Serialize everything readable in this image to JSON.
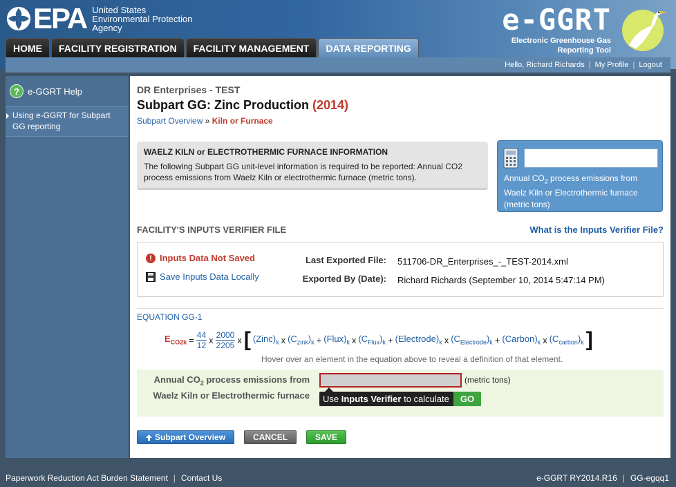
{
  "header": {
    "agency_word": "EPA",
    "agency_lines": [
      "United States",
      "Environmental Protection",
      "Agency"
    ],
    "app_name": "e-GGRT",
    "app_sub_lines": [
      "Electronic Greenhouse Gas",
      "Reporting Tool"
    ]
  },
  "nav": {
    "tabs": [
      {
        "label": "HOME",
        "active": false
      },
      {
        "label": "FACILITY REGISTRATION",
        "active": false
      },
      {
        "label": "FACILITY MANAGEMENT",
        "active": false
      },
      {
        "label": "DATA REPORTING",
        "active": true
      }
    ]
  },
  "userbar": {
    "greeting": "Hello, Richard Richards",
    "my_profile": "My Profile",
    "logout": "Logout",
    "sep": "|"
  },
  "sidebar": {
    "help_label": "e-GGRT Help",
    "help_icon": "?",
    "link_label": "Using e-GGRT for Subpart GG reporting"
  },
  "main": {
    "org_name": "DR Enterprises - TEST",
    "title": "Subpart GG: Zinc Production",
    "year": "(2014)",
    "breadcrumb": {
      "link": "Subpart Overview",
      "separator": " » ",
      "current": "Kiln or Furnace"
    },
    "info": {
      "title": "WAELZ KILN or ELECTROTHERMIC FURNACE INFORMATION",
      "text": "The following Subpart GG unit-level information is required to be reported: Annual CO2 process emissions from Waelz Kiln or electrothermic furnace (metric tons)."
    },
    "calc": {
      "text_pre": "Annual CO",
      "text_sub": "2",
      "text_post": " process emissions from Waelz Kiln or Electrothermic furnace (metric tons)",
      "value": ""
    },
    "verifier": {
      "section_title": "FACILITY'S INPUTS VERIFIER FILE",
      "what_link": "What is the Inputs Verifier File?",
      "error_text": "Inputs Data Not Saved",
      "error_icon": "!",
      "save_link": "Save Inputs Data Locally",
      "last_exported_label": "Last Exported File:",
      "last_exported_value": "511706-DR_Enterprises_-_TEST-2014.xml",
      "exported_by_label": "Exported By (Date):",
      "exported_by_value": "Richard Richards (September 10, 2014 5:47:14 PM)"
    },
    "equation": {
      "title": "EQUATION GG-1",
      "E": "E",
      "E_sub": "CO2k",
      "eq": "=",
      "f1_num": "44",
      "f1_den": "12",
      "x": "x",
      "f2_num": "2000",
      "f2_den": "2205",
      "lbracket": "[",
      "rbracket": "]",
      "plus": "+",
      "zinc": "(Zinc)",
      "czink": "(C",
      "czink_sub": "zink",
      "flux": "(Flux)",
      "cflux": "(C",
      "cflux_sub": "Flux",
      "electrode": "(Electrode)",
      "celectrode": "(C",
      "celectrode_sub": "Electrode",
      "carbon": "(Carbon)",
      "ccarbon": "(C",
      "ccarbon_sub": "carbon",
      "close_paren": ")",
      "k": "k",
      "hover_note": "Hover over an element in the equation above to reveal a definition of that element."
    },
    "result": {
      "label_pre": "Annual CO",
      "label_sub": "2",
      "label_post": " process emissions from Waelz Kiln or Electrothermic furnace",
      "value": "",
      "unit": "(metric tons)",
      "tooltip_pre": "Use ",
      "tooltip_bold": "Inputs Verifier",
      "tooltip_post": " to calculate",
      "go": "GO"
    },
    "buttons": {
      "overview": "Subpart Overview",
      "cancel": "CANCEL",
      "save": "SAVE"
    }
  },
  "footer": {
    "left_1": "Paperwork Reduction Act Burden Statement",
    "left_2": "Contact Us",
    "right_1": "e-GGRT RY2014.R16",
    "right_2": "GG-egqq1",
    "sep": "|"
  },
  "colors": {
    "header_blue": "#2c5e8f",
    "sidebar_blue": "#4a6f93",
    "error_red": "#c0392b",
    "link_blue": "#1f5fa6",
    "go_green": "#3ea43e"
  }
}
